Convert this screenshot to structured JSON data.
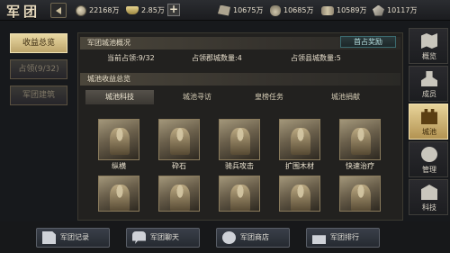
{
  "header": {
    "title": "军团",
    "power": "22168万",
    "gold": "2.85万",
    "resources": [
      "10675万",
      "10685万",
      "10589万",
      "10117万"
    ]
  },
  "left_menu": [
    "收益总览",
    "占领(9/32)",
    "军团建筑"
  ],
  "overview": {
    "section_title": "军团城池概况",
    "award_button": "首占奖励",
    "current_occupied": "当前占领:9/32",
    "prefecture_count": "占领郡城数量:4",
    "county_count": "占领县城数量:5"
  },
  "income": {
    "section_title": "城池收益总览",
    "tabs": [
      "城池科技",
      "城池寻访",
      "皇榜任务",
      "城池捐献"
    ]
  },
  "cards": [
    "纵横",
    "砕石",
    "骑兵攻击",
    "扩围木材",
    "快速治疗",
    "",
    "",
    "",
    "",
    ""
  ],
  "right_nav": [
    "概览",
    "成员",
    "城池",
    "管理",
    "科技"
  ],
  "bottom_bar": [
    "军团记录",
    "军团聊天",
    "军团商店",
    "军团排行"
  ],
  "colors": {
    "accent_gold": "#bca46a",
    "panel": "#22211f",
    "background": "#17191c"
  }
}
